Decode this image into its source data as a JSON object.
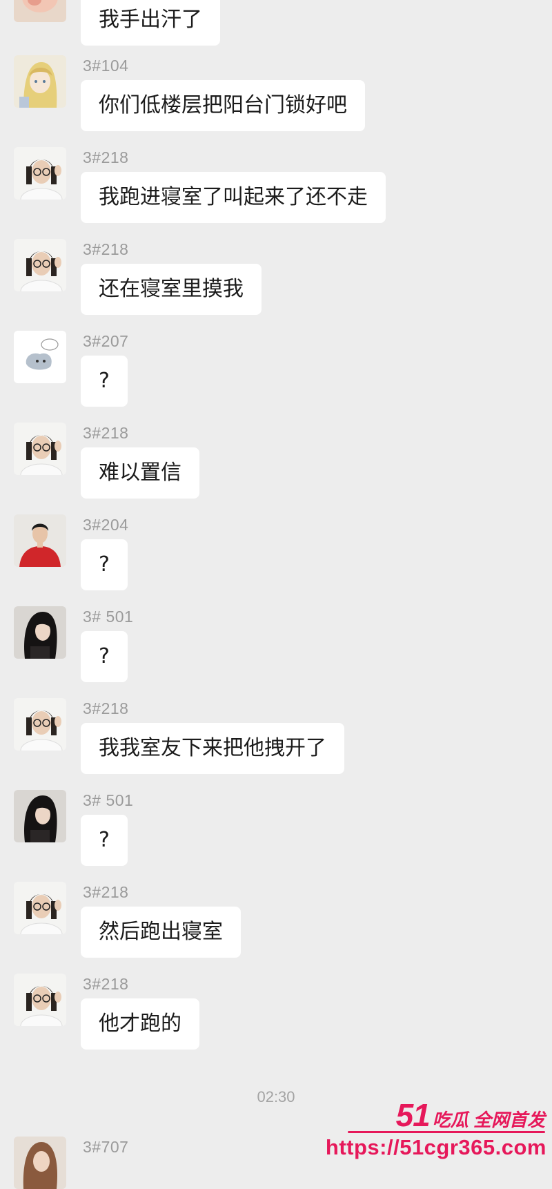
{
  "messages": [
    {
      "sender": "",
      "text": "我手出汗了",
      "avatar": "avatar-peach-icon"
    },
    {
      "sender": "3#104",
      "text": "你们低楼层把阳台门锁好吧",
      "avatar": "avatar-anime-girl-icon"
    },
    {
      "sender": "3#218",
      "text": "我跑进寝室了叫起来了还不走",
      "avatar": "avatar-glasses-person-icon"
    },
    {
      "sender": "3#218",
      "text": "还在寝室里摸我",
      "avatar": "avatar-glasses-person-icon"
    },
    {
      "sender": "3#207",
      "text": "?",
      "avatar": "avatar-cartoon-sketch-icon"
    },
    {
      "sender": "3#218",
      "text": "难以置信",
      "avatar": "avatar-glasses-person-icon"
    },
    {
      "sender": "3#204",
      "text": "?",
      "avatar": "avatar-red-shirt-person-icon"
    },
    {
      "sender": "3# 501",
      "text": "?",
      "avatar": "avatar-dark-hair-person-icon"
    },
    {
      "sender": "3#218",
      "text": "我我室友下来把他拽开了",
      "avatar": "avatar-glasses-person-icon"
    },
    {
      "sender": "3# 501",
      "text": "?",
      "avatar": "avatar-dark-hair-person-icon"
    },
    {
      "sender": "3#218",
      "text": "然后跑出寝室",
      "avatar": "avatar-glasses-person-icon"
    },
    {
      "sender": "3#218",
      "text": "他才跑的",
      "avatar": "avatar-glasses-person-icon"
    },
    {
      "sender": "3#707",
      "text": "",
      "avatar": "avatar-brown-hair-person-icon"
    }
  ],
  "timestamp": "02:30",
  "watermark": {
    "brand_number": "51",
    "brand_tag": "吃瓜 全网首发",
    "url": "https://51cgr365.com"
  },
  "colors": {
    "background": "#ededed",
    "bubble": "#ffffff",
    "watermark": "#e6185a"
  }
}
